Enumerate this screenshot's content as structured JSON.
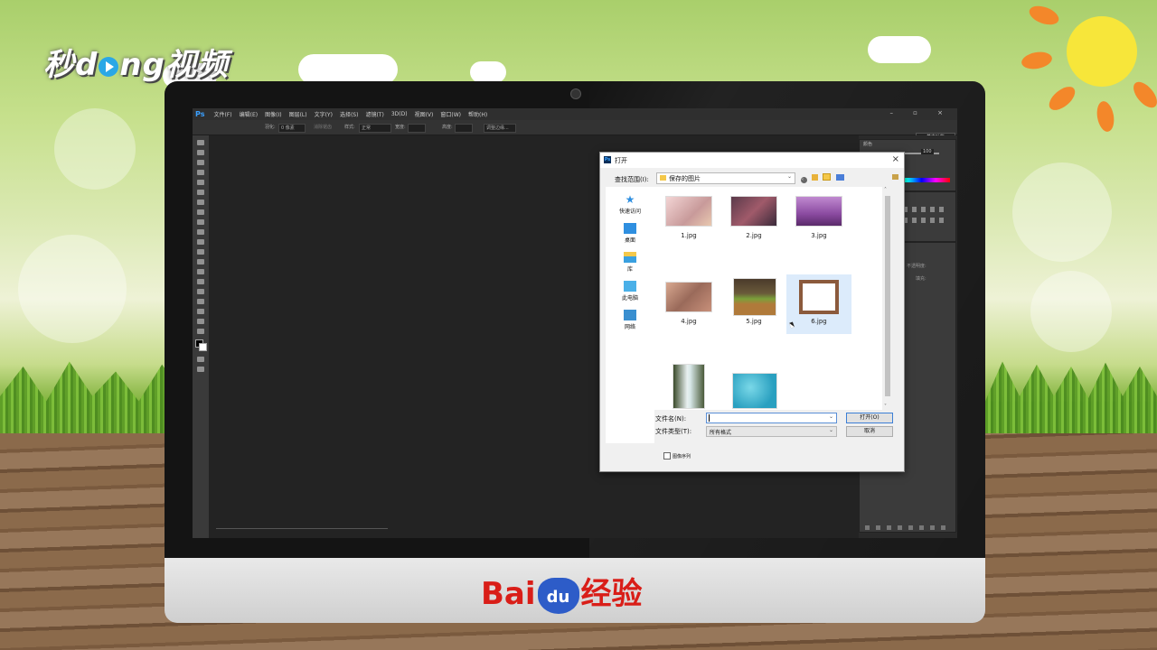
{
  "brand": {
    "logo_prefix": "秒d",
    "logo_suffix": "ng视频",
    "baidu_left": "Bai",
    "baidu_paw": "du",
    "baidu_right": "经验"
  },
  "photoshop": {
    "app_icon": "Ps",
    "menu": [
      "文件(F)",
      "编辑(E)",
      "图像(I)",
      "图层(L)",
      "文字(Y)",
      "选择(S)",
      "滤镜(T)",
      "3D(D)",
      "视图(V)",
      "窗口(W)",
      "帮助(H)"
    ],
    "window_controls": "– ▫ ×",
    "options": {
      "feather_label": "羽化:",
      "feather_value": "0 像素",
      "antialias_label": "消除锯齿",
      "style_label": "样式:",
      "style_value": "正常",
      "width_label": "宽度:",
      "height_label": "高度:",
      "refine_edge": "调整边缘..."
    },
    "workspace": "基本功能",
    "panels": {
      "color_title": "颜色",
      "adjust_title": "调整",
      "layers_title": "图层",
      "opacity_label": "不透明度:",
      "fill_label": "填充:",
      "slider_value": "100"
    }
  },
  "dialog": {
    "title": "打开",
    "look_in_label": "查找范围(I):",
    "look_in_value": "保存的图片",
    "places": [
      {
        "label": "快速访问",
        "icon": "star-icon"
      },
      {
        "label": "桌面",
        "icon": "desktop-icon"
      },
      {
        "label": "库",
        "icon": "library-icon"
      },
      {
        "label": "此电脑",
        "icon": "computer-icon"
      },
      {
        "label": "网络",
        "icon": "network-icon"
      }
    ],
    "files": [
      {
        "name": "1.jpg",
        "thumb_color": "#d9a8a8"
      },
      {
        "name": "2.jpg",
        "thumb_color": "#8a4a5a"
      },
      {
        "name": "3.jpg",
        "thumb_color": "#a36ab0"
      },
      {
        "name": "4.jpg",
        "thumb_color": "#b08070"
      },
      {
        "name": "5.jpg",
        "thumb_color": "#8a6a3a"
      },
      {
        "name": "6.jpg",
        "thumb_color": "#8b5a3c"
      },
      {
        "name": "",
        "thumb_color": "#4a5a3a"
      },
      {
        "name": "",
        "thumb_color": "#3ab0c8"
      }
    ],
    "selected_file": "6.jpg",
    "filename_label": "文件名(N):",
    "filename_value": "",
    "filetype_label": "文件类型(T):",
    "filetype_value": "所有格式",
    "open_button": "打开(O)",
    "cancel_button": "取消",
    "sequence_checkbox": "图像序列"
  }
}
